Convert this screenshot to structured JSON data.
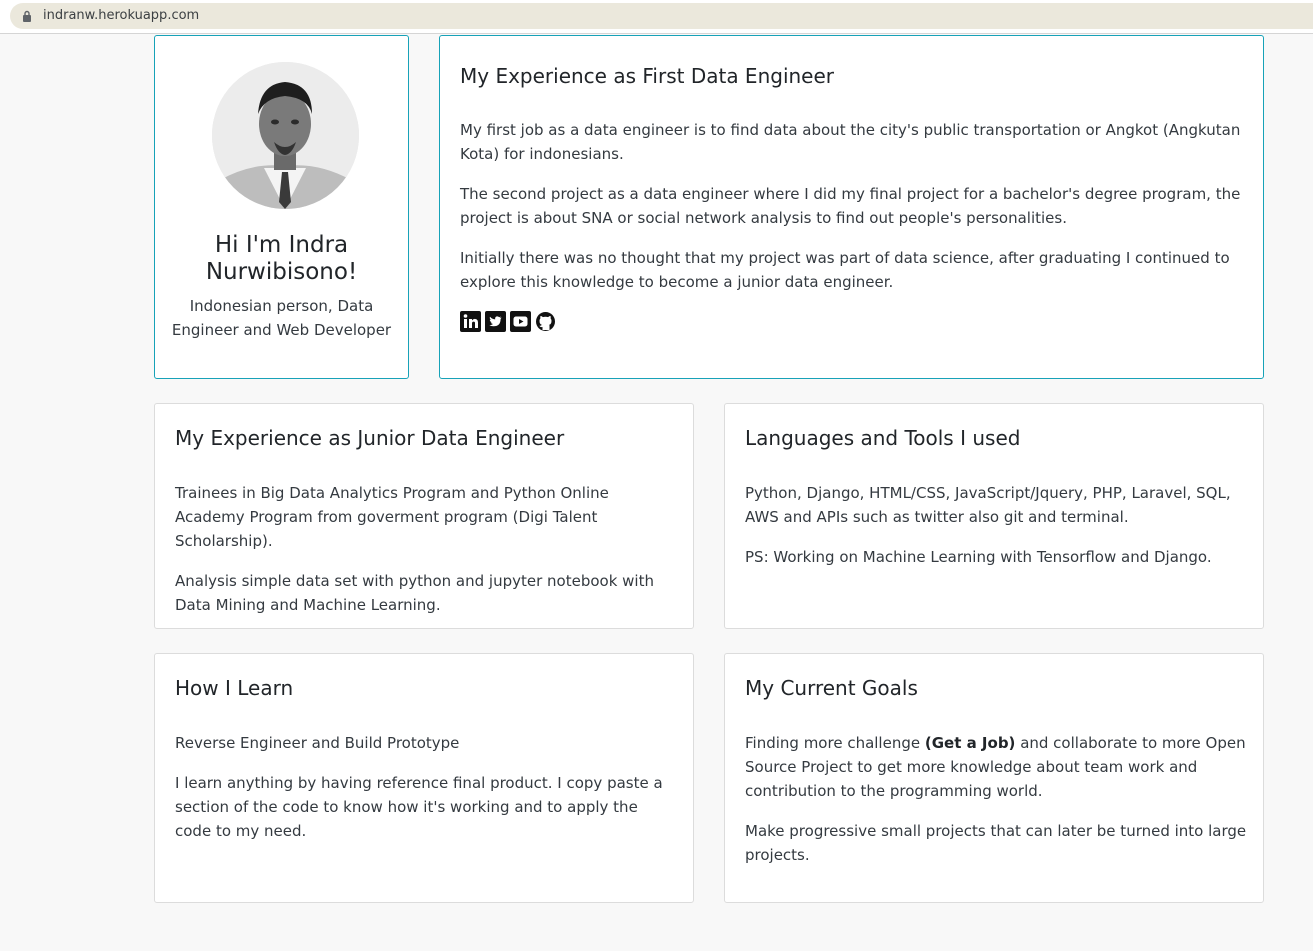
{
  "browser": {
    "url": "indranw.herokuapp.com"
  },
  "profile": {
    "name": "Hi I'm Indra Nurwibisono!",
    "tagline": "Indonesian person, Data Engineer and Web Developer"
  },
  "first_job": {
    "title": "My Experience as First Data Engineer",
    "p1": "My first job as a data engineer is to find data about the city's public transportation or Angkot (Angkutan Kota) for indonesians.",
    "p2": "The second project as a data engineer where I did my final project for a bachelor's degree program, the project is about SNA or social network analysis to find out people's personalities.",
    "p3": "Initially there was no thought that my project was part of data science, after graduating I continued to explore this knowledge to become a junior data engineer.",
    "social_icons": [
      "linkedin-icon",
      "twitter-icon",
      "youtube-icon",
      "github-icon"
    ]
  },
  "junior": {
    "title": "My Experience as Junior Data Engineer",
    "p1": "Trainees in Big Data Analytics Program and Python Online Academy Program from goverment program (Digi Talent Scholarship).",
    "p2": "Analysis simple data set with python and jupyter notebook with Data Mining and Machine Learning."
  },
  "tools": {
    "title": "Languages and Tools I used",
    "p1": "Python, Django, HTML/CSS, JavaScript/Jquery, PHP, Laravel, SQL, AWS and APIs such as twitter also git and terminal.",
    "p2": "PS: Working on Machine Learning with Tensorflow and Django."
  },
  "learn": {
    "title": "How I Learn",
    "p1": "Reverse Engineer and Build Prototype",
    "p2": "I learn anything by having reference final product. I copy paste a section of the code to know how it's working and to apply the code to my need."
  },
  "goals": {
    "title": "My Current Goals",
    "p1_before": "Finding more challenge ",
    "p1_bold": "(Get a Job)",
    "p1_after": " and collaborate to more Open Source Project to get more knowledge about team work and contribution to the programming world.",
    "p2": "Make progressive small projects that can later be turned into large projects."
  },
  "colors": {
    "accent": "#17a2b8",
    "background": "#f8f8f8"
  }
}
